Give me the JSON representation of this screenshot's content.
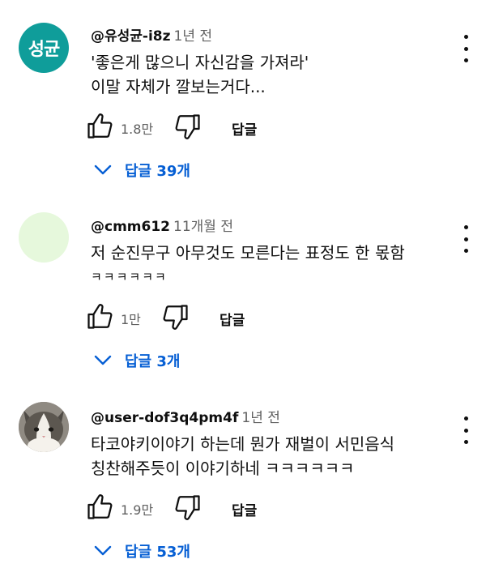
{
  "comments": [
    {
      "avatar_text": "성균",
      "avatar_color": "#0f9d9a",
      "author": "@유성균-i8z",
      "time": "1년 전",
      "lines": [
        "'좋은게 많으니 자신감을 가져라'",
        "이말 자체가 깔보는거다..."
      ],
      "likes": "1.8만",
      "reply_label": "답글",
      "replies_label": "답글 39개"
    },
    {
      "avatar_color": "#e6f8dc",
      "author": "@cmm612",
      "time": "11개월 전",
      "lines": [
        "저 순진무구 아무것도 모른다는 표정도 한 몫함",
        "ㅋㅋㅋㅋㅋㅋ"
      ],
      "likes": "1만",
      "reply_label": "답글",
      "replies_label": "답글 3개"
    },
    {
      "avatar_image": "cat-photo",
      "author": "@user-dof3q4pm4f",
      "time": "1년 전",
      "lines": [
        "타코야키이야기 하는데 뭔가 재벌이 서민음식",
        "칭찬해주듯이 이야기하네 ㅋㅋㅋㅋㅋㅋ"
      ],
      "likes": "1.9만",
      "reply_label": "답글",
      "replies_label": "답글 53개"
    }
  ],
  "icons": {
    "like": "thumb-up-outline-icon",
    "dislike": "thumb-down-outline-icon",
    "menu": "more-vertical-icon",
    "expand": "chevron-down-icon"
  },
  "colors": {
    "link_blue": "#065fd4",
    "secondary_text": "#606060",
    "primary_text": "#0f0f0f"
  }
}
